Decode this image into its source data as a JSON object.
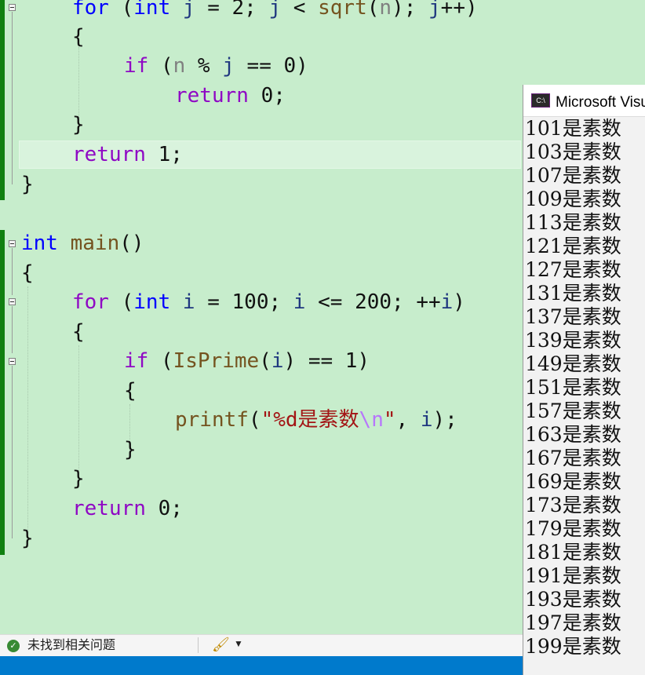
{
  "editor": {
    "lines": [
      [
        [
          "k",
          "for"
        ],
        [
          "n",
          " ("
        ],
        [
          "k",
          "int"
        ],
        [
          "n",
          " "
        ],
        [
          "v",
          "j"
        ],
        [
          "n",
          " = 2; "
        ],
        [
          "v",
          "j"
        ],
        [
          "n",
          " < "
        ],
        [
          "f",
          "sqrt"
        ],
        [
          "n",
          "("
        ],
        [
          "p",
          "n"
        ],
        [
          "n",
          "); "
        ],
        [
          "v",
          "j"
        ],
        [
          "n",
          "++)"
        ]
      ],
      [
        [
          "n",
          "{"
        ]
      ],
      [
        [
          "c",
          "if"
        ],
        [
          "n",
          " ("
        ],
        [
          "p",
          "n"
        ],
        [
          "n",
          " % "
        ],
        [
          "v",
          "j"
        ],
        [
          "n",
          " == 0)"
        ]
      ],
      [
        [
          "c",
          "return"
        ],
        [
          "n",
          " 0;"
        ]
      ],
      [
        [
          "n",
          "}"
        ]
      ],
      [
        [
          "c",
          "return"
        ],
        [
          "n",
          " 1;"
        ]
      ],
      [
        [
          "n",
          "}"
        ]
      ],
      [],
      [
        [
          "k",
          "int"
        ],
        [
          "n",
          " "
        ],
        [
          "f",
          "main"
        ],
        [
          "n",
          "()"
        ]
      ],
      [
        [
          "n",
          "{"
        ]
      ],
      [
        [
          "c",
          "for"
        ],
        [
          "n",
          " ("
        ],
        [
          "k",
          "int"
        ],
        [
          "n",
          " "
        ],
        [
          "v",
          "i"
        ],
        [
          "n",
          " = 100; "
        ],
        [
          "v",
          "i"
        ],
        [
          "n",
          " <= 200; ++"
        ],
        [
          "v",
          "i"
        ],
        [
          "n",
          ")"
        ]
      ],
      [
        [
          "n",
          "{"
        ]
      ],
      [
        [
          "c",
          "if"
        ],
        [
          "n",
          " ("
        ],
        [
          "f",
          "IsPrime"
        ],
        [
          "n",
          "("
        ],
        [
          "v",
          "i"
        ],
        [
          "n",
          ") == 1)"
        ]
      ],
      [
        [
          "n",
          "{"
        ]
      ],
      [
        [
          "f",
          "printf"
        ],
        [
          "n",
          "("
        ],
        [
          "s",
          "\"%d是素数"
        ],
        [
          "e",
          "\\n"
        ],
        [
          "s",
          "\""
        ],
        [
          "n",
          ", "
        ],
        [
          "v",
          "i"
        ],
        [
          "n",
          ");"
        ]
      ],
      [
        [
          "n",
          "}"
        ]
      ],
      [
        [
          "n",
          "}"
        ]
      ],
      [
        [
          "c",
          "return"
        ],
        [
          "n",
          " 0;"
        ]
      ],
      [
        [
          "n",
          "}"
        ]
      ]
    ]
  },
  "console": {
    "title": "Microsoft Visual Studio 调试控制台",
    "lines": [
      "101是素数",
      "103是素数",
      "107是素数",
      "109是素数",
      "113是素数",
      "121是素数",
      "127是素数",
      "131是素数",
      "137是素数",
      "139是素数",
      "149是素数",
      "151是素数",
      "157是素数",
      "163是素数",
      "167是素数",
      "169是素数",
      "173是素数",
      "179是素数",
      "181是素数",
      "191是素数",
      "193是素数",
      "197是素数",
      "199是素数"
    ]
  },
  "status": {
    "issues_text": "未找到相关问题",
    "ok_icon": "check-circle-icon",
    "cleanup_icon": "code-cleanup-brush-icon"
  }
}
